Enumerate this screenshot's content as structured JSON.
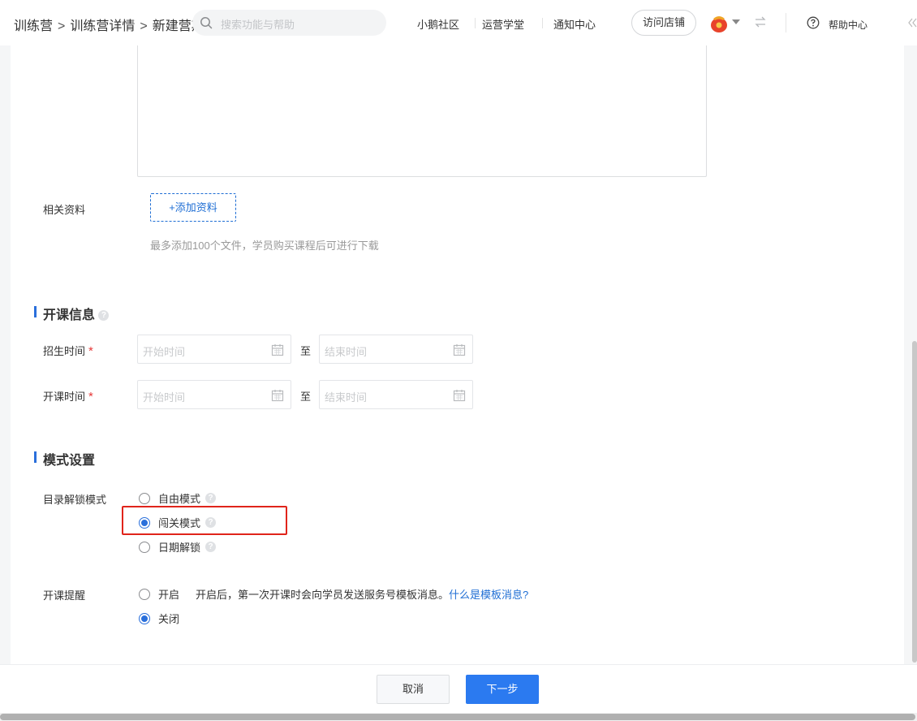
{
  "header": {
    "breadcrumb": [
      "训练营",
      "训练营详情",
      "新建营期"
    ],
    "breadcrumb_sep": ">",
    "search_placeholder": "搜索功能与帮助",
    "nav_links": [
      "小鹅社区",
      "运营学堂",
      "通知中心"
    ],
    "visit_store": "访问店铺",
    "help_center": "帮助中心"
  },
  "materials": {
    "label": "相关资料",
    "add_button": "+添加资料",
    "hint": "最多添加100个文件，学员购买课程后可进行下载"
  },
  "course_info": {
    "title": "开课信息",
    "enroll_label": "招生时间",
    "start_label": "开课时间",
    "required_mark": "*",
    "start_placeholder": "开始时间",
    "end_placeholder": "结束时间",
    "to_text": "至"
  },
  "mode": {
    "title": "模式设置",
    "unlock_label": "目录解锁模式",
    "options": [
      {
        "label": "自由模式",
        "selected": false
      },
      {
        "label": "闯关模式",
        "selected": true
      },
      {
        "label": "日期解锁",
        "selected": false
      }
    ],
    "reminder_label": "开课提醒",
    "reminder_on": "开启",
    "reminder_desc": "开启后，第一次开课时会向学员发送服务号模板消息。",
    "reminder_link": "什么是模板消息?",
    "reminder_off": "关闭",
    "reminder_selected": "关闭"
  },
  "footer": {
    "cancel": "取消",
    "next": "下一步"
  },
  "colors": {
    "accent": "#2a6fdb",
    "primary_button": "#2b7af0",
    "highlight_box": "#e0241b",
    "required": "#e63838"
  }
}
